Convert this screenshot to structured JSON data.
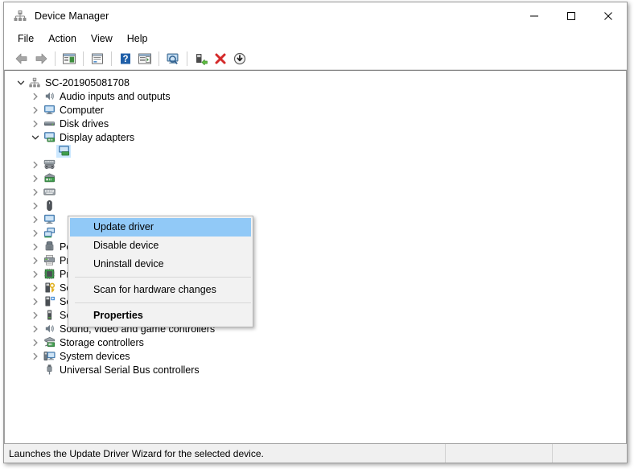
{
  "window": {
    "title": "Device Manager",
    "icon": "device-manager-icon",
    "controls": {
      "minimize": "minimize-icon",
      "maximize": "maximize-icon",
      "close": "close-icon"
    }
  },
  "menubar": {
    "items": [
      {
        "label": "File"
      },
      {
        "label": "Action"
      },
      {
        "label": "View"
      },
      {
        "label": "Help"
      }
    ]
  },
  "toolbar": {
    "buttons": [
      {
        "name": "back-icon"
      },
      {
        "name": "forward-icon"
      },
      {
        "name": "show-hide-console-tree-icon"
      },
      {
        "name": "properties-icon"
      },
      {
        "name": "help-icon"
      },
      {
        "name": "show-hide-action-pane-icon"
      },
      {
        "name": "scan-display-icon"
      },
      {
        "name": "scan-for-hardware-changes-icon"
      },
      {
        "name": "uninstall-device-icon"
      },
      {
        "name": "update-driver-icon"
      }
    ]
  },
  "tree": {
    "root": {
      "label": "SC-201905081708",
      "icon": "computer-root-icon",
      "expanded": true
    },
    "items": [
      {
        "label": "Audio inputs and outputs",
        "icon": "speaker-icon",
        "expandable": true,
        "expanded": false,
        "hidden_label": false,
        "selected": false
      },
      {
        "label": "Computer",
        "icon": "monitor-icon",
        "expandable": true,
        "expanded": false,
        "hidden_label": false,
        "selected": false
      },
      {
        "label": "Disk drives",
        "icon": "disk-drive-icon",
        "expandable": true,
        "expanded": false,
        "hidden_label": false,
        "selected": false
      },
      {
        "label": "Display adapters",
        "icon": "display-adapter-icon",
        "expandable": true,
        "expanded": true,
        "hidden_label": false,
        "selected": false
      },
      {
        "label": "",
        "icon": "display-adapter-child-icon",
        "expandable": false,
        "expanded": false,
        "hidden_label": true,
        "selected": true,
        "child": true
      },
      {
        "label": "",
        "icon": "human-interface-devices-icon",
        "expandable": true,
        "expanded": false,
        "hidden_label": true,
        "selected": false
      },
      {
        "label": "",
        "icon": "ide-ata-controllers-icon",
        "expandable": true,
        "expanded": false,
        "hidden_label": true,
        "selected": false
      },
      {
        "label": "",
        "icon": "keyboard-icon",
        "expandable": true,
        "expanded": false,
        "hidden_label": true,
        "selected": false
      },
      {
        "label": "",
        "icon": "mouse-icon",
        "expandable": true,
        "expanded": false,
        "hidden_label": true,
        "selected": false
      },
      {
        "label": "",
        "icon": "monitor-icon",
        "expandable": true,
        "expanded": false,
        "hidden_label": true,
        "selected": false
      },
      {
        "label": "",
        "icon": "network-adapter-icon",
        "expandable": true,
        "expanded": false,
        "hidden_label": true,
        "selected": false
      },
      {
        "label": "Ports (COM & LPT)",
        "icon": "port-icon",
        "expandable": true,
        "expanded": false,
        "hidden_label": false,
        "selected": false
      },
      {
        "label": "Print queues",
        "icon": "printer-icon",
        "expandable": true,
        "expanded": false,
        "hidden_label": false,
        "selected": false
      },
      {
        "label": "Processors",
        "icon": "processor-icon",
        "expandable": true,
        "expanded": false,
        "hidden_label": false,
        "selected": false
      },
      {
        "label": "Security devices",
        "icon": "security-device-icon",
        "expandable": true,
        "expanded": false,
        "hidden_label": false,
        "selected": false
      },
      {
        "label": "Software components",
        "icon": "software-component-icon",
        "expandable": true,
        "expanded": false,
        "hidden_label": false,
        "selected": false
      },
      {
        "label": "Software devices",
        "icon": "software-device-icon",
        "expandable": true,
        "expanded": false,
        "hidden_label": false,
        "selected": false
      },
      {
        "label": "Sound, video and game controllers",
        "icon": "speaker-icon",
        "expandable": true,
        "expanded": false,
        "hidden_label": false,
        "selected": false
      },
      {
        "label": "Storage controllers",
        "icon": "storage-controller-icon",
        "expandable": true,
        "expanded": false,
        "hidden_label": false,
        "selected": false
      },
      {
        "label": "System devices",
        "icon": "system-device-icon",
        "expandable": true,
        "expanded": false,
        "hidden_label": false,
        "selected": false
      },
      {
        "label": "Universal Serial Bus controllers",
        "icon": "usb-controller-icon",
        "expandable": false,
        "expanded": false,
        "hidden_label": false,
        "selected": false
      }
    ]
  },
  "context_menu": {
    "items": [
      {
        "label": "Update driver",
        "highlighted": true,
        "bold": false
      },
      {
        "label": "Disable device",
        "highlighted": false,
        "bold": false
      },
      {
        "label": "Uninstall device",
        "highlighted": false,
        "bold": false
      },
      {
        "label": "Scan for hardware changes",
        "highlighted": false,
        "bold": false
      },
      {
        "label": "Properties",
        "highlighted": false,
        "bold": true
      }
    ]
  },
  "statusbar": {
    "message": "Launches the Update Driver Wizard for the selected device.",
    "panel2": "",
    "panel3": ""
  },
  "colors": {
    "selection": "#cce8ff",
    "menu_highlight": "#91c9f7",
    "window_bg": "#f0f0f0",
    "tree_bg": "#ffffff"
  }
}
